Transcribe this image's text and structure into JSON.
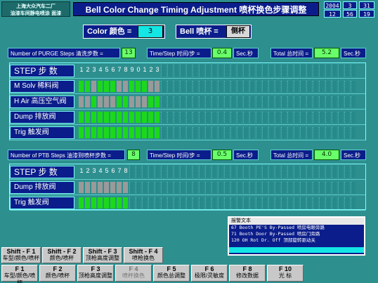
{
  "header": {
    "company_line1": "上海大众汽车二厂",
    "company_line2": "油漆车间静电喷涂  面漆",
    "title": "Bell Color Change Timing Adjustment 喷杯换色步骤调整",
    "date": {
      "year": "2004",
      "month": "3",
      "day": "31"
    },
    "time": {
      "hour": "12",
      "minute": "56",
      "second": "19"
    }
  },
  "selectors": {
    "color_label": "Color 颜色 =",
    "color_value": "3",
    "bell_label": "Bell  喷杯 =",
    "bell_value": "侧杯"
  },
  "purge": {
    "steps_label": "Number of PURGE Steps 清洗步数 =",
    "steps_value": "13",
    "time_step_label": "Time/Step 时间/步 =",
    "time_step_value": "0.4",
    "time_step_unit": "Sec.秒",
    "total_label": "Total 总时间 =",
    "total_value": "5.2",
    "total_unit": "Sec.秒",
    "rows": [
      {
        "label": "STEP 步 数",
        "kind": "step"
      },
      {
        "label": "M Solv  稀料阀",
        "pattern": "1101110011100"
      },
      {
        "label": "H Air  高压空气阀",
        "pattern": "0010001100011"
      },
      {
        "label": "Dump  排放阀",
        "pattern": "1111111111111"
      },
      {
        "label": "Trig    触发阀",
        "pattern": "1111111111111"
      }
    ],
    "step_numbers": [
      "1",
      "2",
      "3",
      "4",
      "5",
      "6",
      "7",
      "8",
      "9",
      "0",
      "1",
      "2",
      "3"
    ]
  },
  "ptb": {
    "steps_label": "Number of PTB Steps 油漆到喷杯步数 =",
    "steps_value": "8",
    "time_step_label": "Time/Step 时间/步 =",
    "time_step_value": "0.5",
    "time_step_unit": "Sec.秒",
    "total_label": "Total 总时间 =",
    "total_value": "4.0",
    "total_unit": "Sec.秒",
    "rows": [
      {
        "label": "STEP 步 数",
        "kind": "step"
      },
      {
        "label": "Dump  排放阀",
        "pattern": "00000000"
      },
      {
        "label": "Trig    触发阀",
        "pattern": "11111111"
      }
    ],
    "step_numbers": [
      "1",
      "2",
      "3",
      "4",
      "5",
      "6",
      "7",
      "8"
    ]
  },
  "alarm": {
    "title": "报警文本",
    "lines": [
      "67 Booth PE'S By-Passed 喷房电眼旁路",
      "71 Booth Door By-Passed 喷房门旁路",
      "120 OH Rot Dr. Off  顶部旋转驱动关"
    ]
  },
  "shift_keys": [
    {
      "key": "Shift - F 1",
      "label": "车型/颜色/喷杯"
    },
    {
      "key": "Shift - F 2",
      "label": "颜色/喷杯"
    },
    {
      "key": "Shift - F 3",
      "label": "顶枪高度调整"
    },
    {
      "key": "Shift - F 4",
      "label": "喷枪换色"
    }
  ],
  "fkeys": [
    {
      "key": "F 1",
      "label": "车型/颜色/喷杯"
    },
    {
      "key": "F 2",
      "label": "颜色/喷杯"
    },
    {
      "key": "F 3",
      "label": "顶枪高度调整"
    },
    {
      "key": "F 4",
      "label": "喷杯换色",
      "disabled": true
    },
    {
      "key": "F 5",
      "label": "颜色总调整"
    },
    {
      "key": "F 6",
      "label": "极限/灵敏度"
    },
    {
      "key": "F 8",
      "label": "修改数据"
    },
    {
      "key": "F 10",
      "label": "光 标"
    }
  ],
  "colors": {
    "bg": "#2e8f8f",
    "navy": "#0b1d8a",
    "on": "#1bd81b",
    "off": "#9a9a9a",
    "value": "#6aff6a"
  }
}
